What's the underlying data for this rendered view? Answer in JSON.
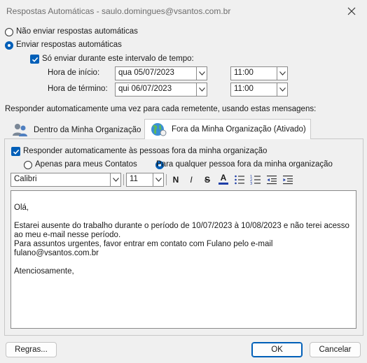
{
  "window": {
    "title": "Respostas Automáticas - saulo.domingues@vsantos.com.br"
  },
  "options": {
    "no_reply_label": "Não enviar respostas automáticas",
    "send_reply_label": "Enviar respostas automáticas",
    "interval_label": "Só enviar durante este intervalo de tempo:"
  },
  "schedule": {
    "start_label": "Hora de início:",
    "start_date": "qua 05/07/2023",
    "start_time": "11:00",
    "end_label": "Hora de término:",
    "end_date": "qui 06/07/2023",
    "end_time": "11:00"
  },
  "reply_once_label": "Responder automaticamente uma vez para cada remetente, usando estas mensagens:",
  "tabs": [
    {
      "label": "Dentro da Minha Organização",
      "icon": "people-icon"
    },
    {
      "label": "Fora da Minha Organização (Ativado)",
      "icon": "globe-icon"
    }
  ],
  "outside": {
    "respond_label": "Responder automaticamente às pessoas fora da minha organização",
    "contacts_only_label": "Apenas para meus Contatos",
    "anyone_label": "Para qualquer pessoa fora da minha organização"
  },
  "toolbar": {
    "font": "Calibri",
    "size": "11",
    "bold": "N",
    "italic": "I",
    "strike": "S",
    "color": "A",
    "colors": {
      "font_color_bar": "#1f3fa8",
      "accent": "#005fb8"
    }
  },
  "message": {
    "greeting": "Olá,",
    "line1": "Estarei ausente do trabalho durante o período de 10/07/2023 à 10/08/2023 e não terei acesso",
    "line2": "ao meu e-mail nesse período.",
    "line3": "Para assuntos urgentes, favor entrar em contato com Fulano pelo e-mail",
    "line4": "fulano@vsantos.com.br",
    "closing": "Atenciosamente,"
  },
  "buttons": {
    "rules": "Regras...",
    "ok": "OK",
    "cancel": "Cancelar"
  }
}
